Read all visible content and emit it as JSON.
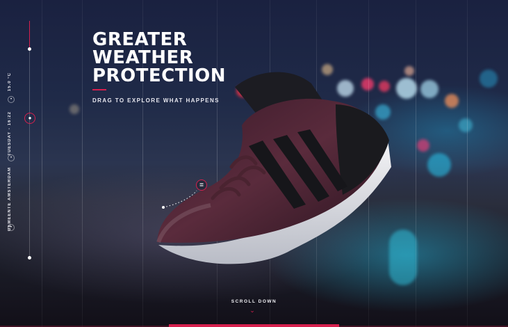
{
  "hero": {
    "headline": [
      "GREATER",
      "WEATHER",
      "PROTECTION"
    ],
    "subtitle": "DRAG TO EXPLORE WHAT HAPPENS"
  },
  "sidebar": {
    "temperature": "15.0 °C",
    "date_time": "TUESDAY - 16:22",
    "location": "GEMEENTE AMSTERDAM"
  },
  "hotspot": {
    "symbol": "="
  },
  "scroll": {
    "label": "SCROLL DOWN"
  },
  "colors": {
    "accent": "#d6204e",
    "text": "#ffffff"
  },
  "icons": {
    "temperature": "thermometer-icon",
    "time": "clock-icon",
    "location": "location-pin-icon",
    "rain": "raindrop-icon",
    "scroll": "chevron-down-icon"
  }
}
